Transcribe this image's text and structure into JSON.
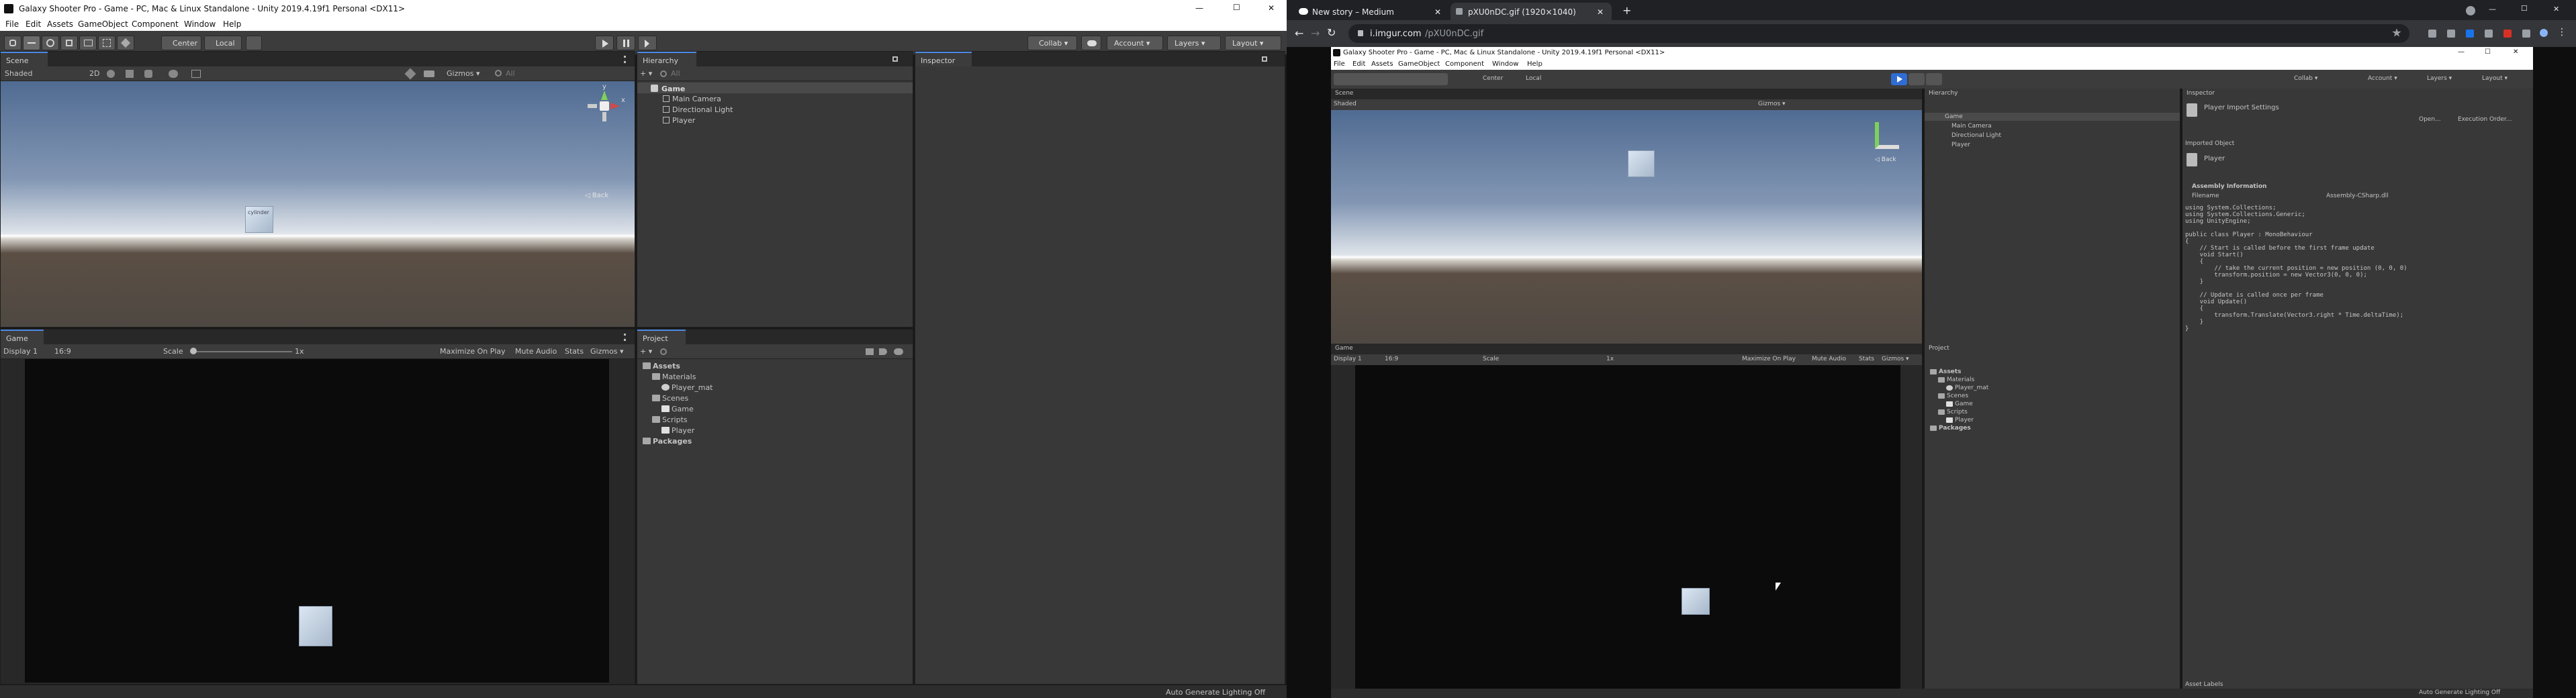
{
  "left_window": {
    "title": "Galaxy Shooter Pro - Game - PC, Mac & Linux Standalone - Unity 2019.4.19f1 Personal <DX11>",
    "window_controls": [
      "—",
      "☐",
      "✕"
    ],
    "menu": [
      "File",
      "Edit",
      "Assets",
      "GameObject",
      "Component",
      "Window",
      "Help"
    ],
    "toolbar": {
      "pivot": "Center",
      "space": "Local",
      "collab": "Collab ▾",
      "account": "Account ▾",
      "layers": "Layers ▾",
      "layout": "Layout ▾"
    },
    "scene": {
      "tab": "Scene",
      "shading": "Shaded",
      "mode_2d": "2D",
      "gizmos": "Gizmos ▾",
      "search": "All",
      "view_label": "◁ Back",
      "gizmo_y": "y",
      "gizmo_x": "x",
      "cube_label": "cylinder"
    },
    "game": {
      "tab": "Game",
      "display": "Display 1",
      "aspect": "16:9",
      "scale_label": "Scale",
      "scale_value": "1x",
      "options": [
        "Maximize On Play",
        "Mute Audio",
        "Stats",
        "Gizmos ▾"
      ]
    },
    "hierarchy": {
      "tab": "Hierarchy",
      "search": "All",
      "scene": "Game",
      "items": [
        "Main Camera",
        "Directional Light",
        "Player"
      ]
    },
    "project": {
      "tab": "Project",
      "tree": [
        {
          "label": "Assets",
          "depth": 0,
          "kind": "folder"
        },
        {
          "label": "Materials",
          "depth": 1,
          "kind": "folder"
        },
        {
          "label": "Player_mat",
          "depth": 2,
          "kind": "material"
        },
        {
          "label": "Scenes",
          "depth": 1,
          "kind": "folder"
        },
        {
          "label": "Game",
          "depth": 2,
          "kind": "scene"
        },
        {
          "label": "Scripts",
          "depth": 1,
          "kind": "folder"
        },
        {
          "label": "Player",
          "depth": 2,
          "kind": "script"
        },
        {
          "label": "Packages",
          "depth": 0,
          "kind": "folder"
        }
      ]
    },
    "inspector": {
      "tab": "Inspector"
    },
    "status": "Auto Generate Lighting Off"
  },
  "browser": {
    "tabs": [
      {
        "title": "New story – Medium",
        "close": "✕"
      },
      {
        "title": "pXU0nDC.gif (1920×1040)",
        "close": "✕"
      }
    ],
    "new_tab": "+",
    "window_controls": [
      "—",
      "☐",
      "✕"
    ],
    "url_host": "i.imgur.com",
    "url_path": "/pXU0nDC.gif",
    "gif": {
      "title": "Galaxy Shooter Pro - Game - PC, Mac & Linux Standalone - Unity 2019.4.19f1 Personal <DX11>",
      "window_controls": [
        "—",
        "☐",
        "✕"
      ],
      "menu": [
        "File",
        "Edit",
        "Assets",
        "GameObject",
        "Component",
        "Window",
        "Help"
      ],
      "toolbar": {
        "pivot": "Center",
        "space": "Local",
        "collab": "Collab ▾",
        "account": "Account ▾",
        "layers": "Layers ▾",
        "layout": "Layout ▾"
      },
      "scene": {
        "tab": "Scene",
        "shading": "Shaded",
        "gizmos": "Gizmos ▾",
        "view_label": "◁ Back"
      },
      "game": {
        "tab": "Game",
        "display": "Display 1",
        "aspect": "16:9",
        "scale_label": "Scale",
        "scale_value": "1x",
        "options": [
          "Maximize On Play",
          "Mute Audio",
          "Stats",
          "Gizmos ▾"
        ]
      },
      "hierarchy": {
        "tab": "Hierarchy",
        "scene": "Game",
        "items": [
          "Main Camera",
          "Directional Light",
          "Player"
        ]
      },
      "project": {
        "tab": "Project",
        "tree": [
          {
            "label": "Assets",
            "depth": 0,
            "kind": "folder"
          },
          {
            "label": "Materials",
            "depth": 1,
            "kind": "folder"
          },
          {
            "label": "Player_mat",
            "depth": 2,
            "kind": "material"
          },
          {
            "label": "Scenes",
            "depth": 1,
            "kind": "folder"
          },
          {
            "label": "Game",
            "depth": 2,
            "kind": "scene"
          },
          {
            "label": "Scripts",
            "depth": 1,
            "kind": "folder"
          },
          {
            "label": "Player",
            "depth": 2,
            "kind": "script"
          },
          {
            "label": "Packages",
            "depth": 0,
            "kind": "folder"
          }
        ]
      },
      "inspector": {
        "tab": "Inspector",
        "header": "Player Import Settings",
        "open_btn": "Open...",
        "exec_btn": "Execution Order...",
        "imported_object": "Imported Object",
        "object_name": "Player",
        "assembly_info": "Assembly Information",
        "filename_label": "Filename",
        "filename_value": "Assembly-CSharp.dll",
        "code": [
          "using System.Collections;",
          "using System.Collections.Generic;",
          "using UnityEngine;",
          "",
          "public class Player : MonoBehaviour",
          "{",
          "    // Start is called before the first frame update",
          "    void Start()",
          "    {",
          "        // take the current position = new position (0, 0, 0)",
          "        transform.position = new Vector3(0, 0, 0);",
          "    }",
          "",
          "    // Update is called once per frame",
          "    void Update()",
          "    {",
          "        transform.Translate(Vector3.right * Time.deltaTime);",
          "    }",
          "}"
        ],
        "asset_labels": "Asset Labels"
      },
      "status": "Auto Generate Lighting Off"
    }
  },
  "colors": {
    "unity_panel": "#383838",
    "unity_toolbar": "#3c3c3c",
    "tab_accent": "#4d8be6",
    "chrome_dark": "#202124",
    "chrome_toolbar": "#35363a"
  }
}
